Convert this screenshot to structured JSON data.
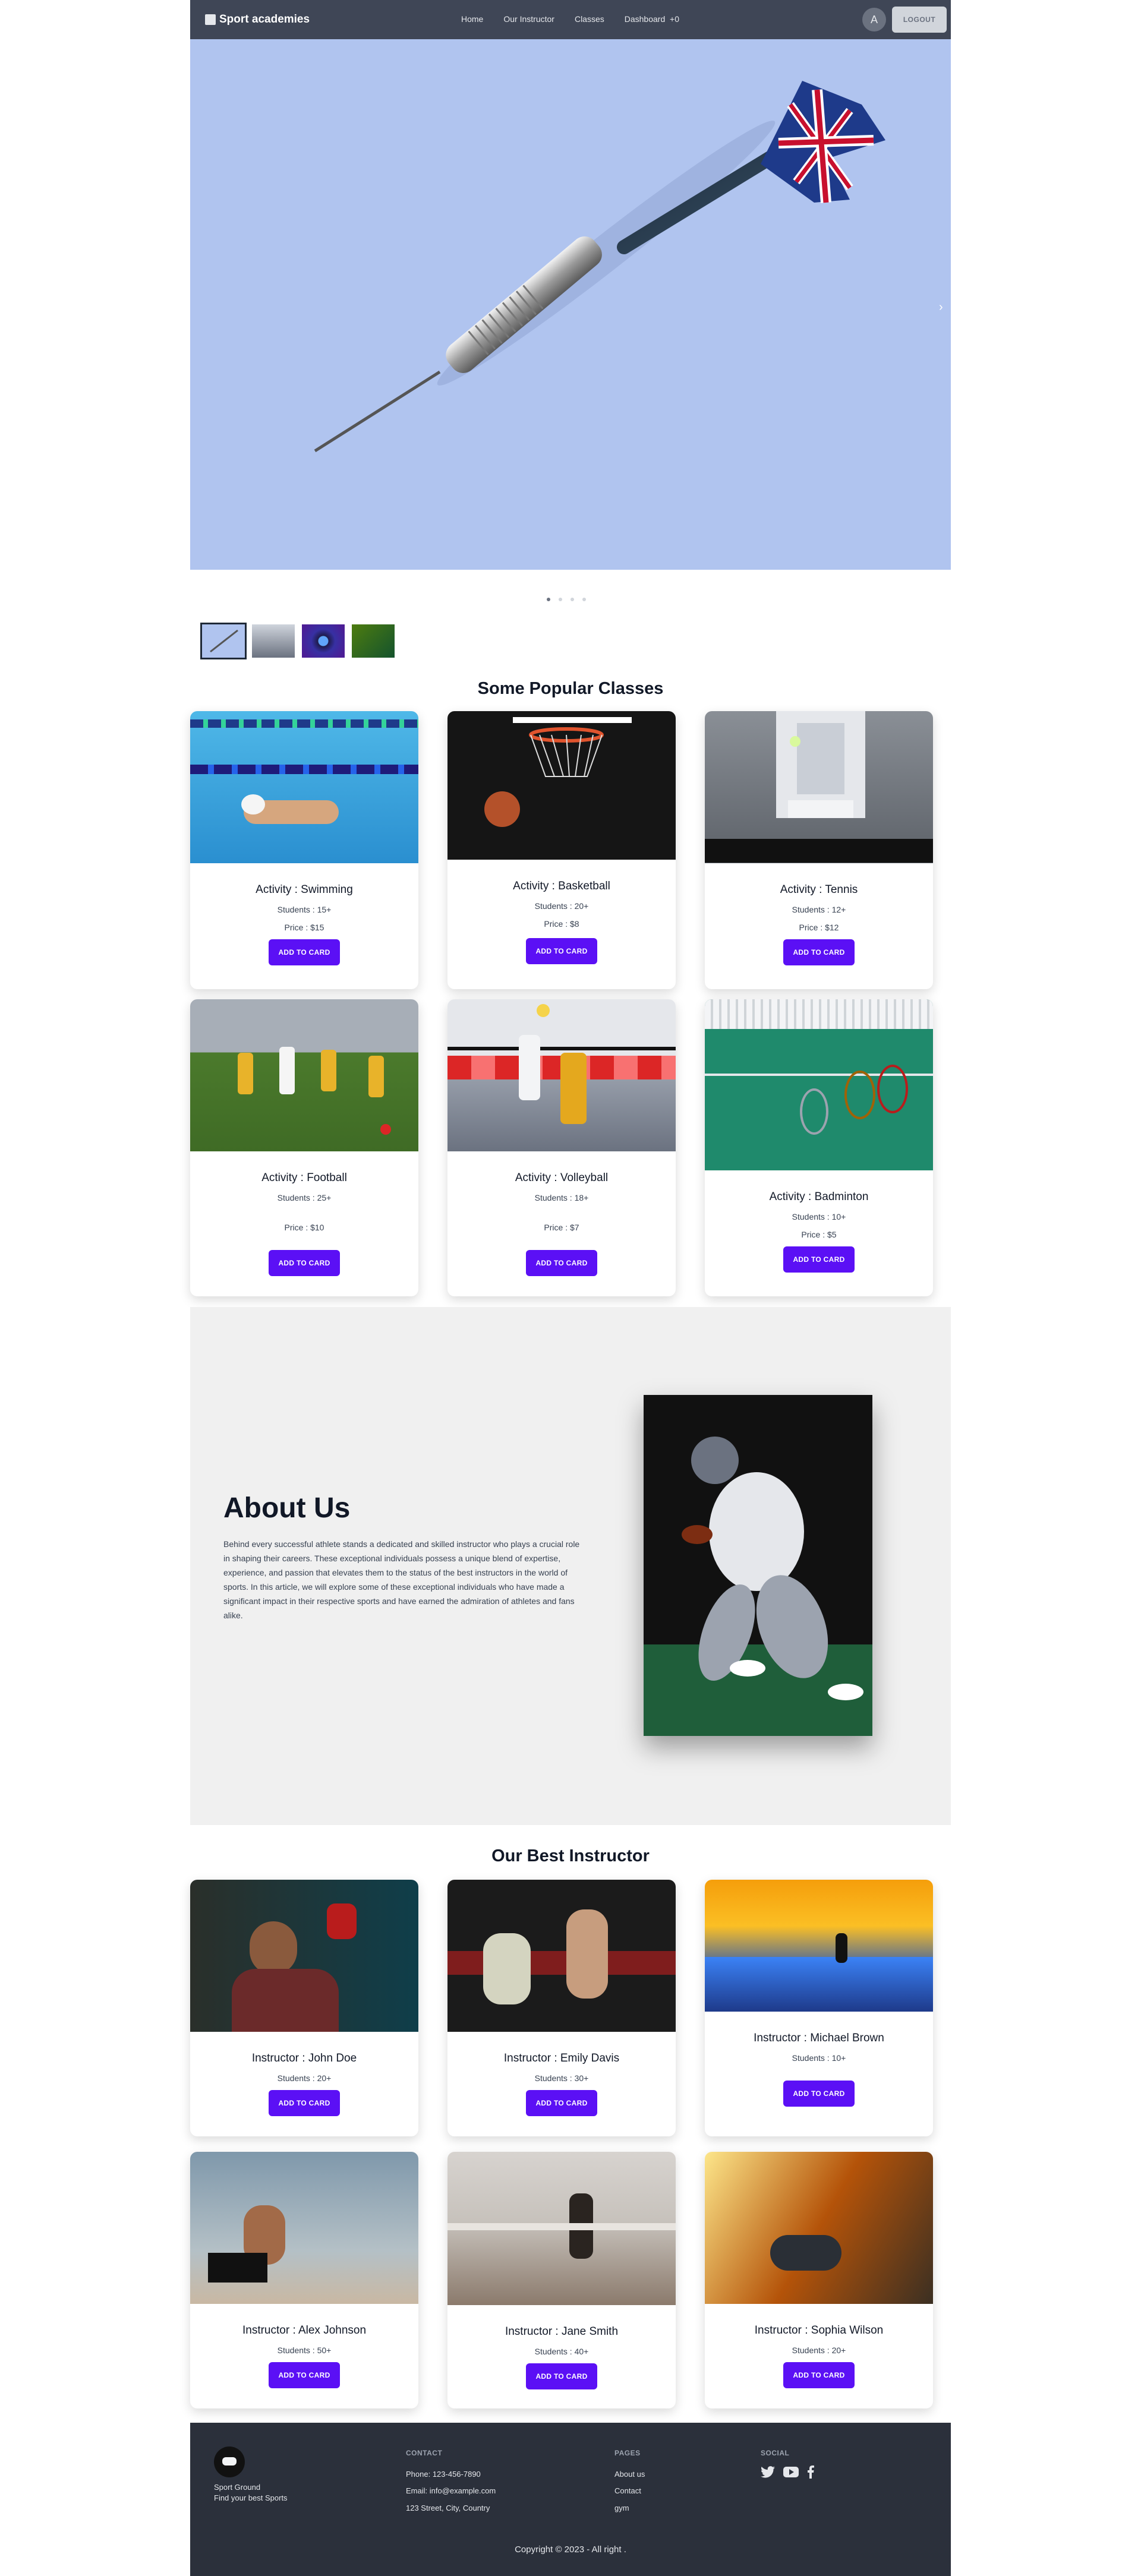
{
  "navbar": {
    "brand": "Sport academies",
    "links": [
      "Home",
      "Our Instructor",
      "Classes",
      "Dashboard"
    ],
    "cart_count": "+0",
    "avatar_letter": "A",
    "logout": "LOGOUT"
  },
  "hero": {
    "next_arrow": "›"
  },
  "classes": {
    "title": "Some Popular Classes",
    "button": "ADD TO CARD",
    "items": [
      {
        "activity": "Activity : Swimming",
        "students": "Students : 15+",
        "price": "Price : $15"
      },
      {
        "activity": "Activity : Basketball",
        "students": "Students : 20+",
        "price": "Price : $8"
      },
      {
        "activity": "Activity : Tennis",
        "students": "Students : 12+",
        "price": "Price : $12"
      },
      {
        "activity": "Activity : Football",
        "students": "Students : 25+",
        "price": "Price : $10"
      },
      {
        "activity": "Activity : Volleyball",
        "students": "Students : 18+",
        "price": "Price : $7"
      },
      {
        "activity": "Activity : Badminton",
        "students": "Students : 10+",
        "price": "Price : $5"
      }
    ]
  },
  "about": {
    "title": "About Us",
    "text": "Behind every successful athlete stands a dedicated and skilled instructor who plays a crucial role in shaping their careers. These exceptional individuals possess a unique blend of expertise, experience, and passion that elevates them to the status of the best instructors in the world of sports. In this article, we will explore some of these exceptional individuals who have made a significant impact in their respective sports and have earned the admiration of athletes and fans alike."
  },
  "instructors": {
    "title": "Our Best Instructor",
    "button": "ADD TO CARD",
    "items": [
      {
        "name": "Instructor : John Doe",
        "students": "Students : 20+"
      },
      {
        "name": "Instructor : Emily Davis",
        "students": "Students : 30+"
      },
      {
        "name": "Instructor : Michael Brown",
        "students": "Students : 10+"
      },
      {
        "name": "Instructor : Alex Johnson",
        "students": "Students : 50+"
      },
      {
        "name": "Instructor : Jane Smith",
        "students": "Students : 40+"
      },
      {
        "name": "Instructor : Sophia Wilson",
        "students": "Students : 20+"
      }
    ]
  },
  "footer": {
    "brand_name": "Sport Ground",
    "tagline": "Find your best Sports",
    "contact_title": "CONTACT",
    "phone": "Phone: 123-456-7890",
    "email": "Email: info@example.com",
    "address": "123 Street, City, Country",
    "pages_title": "PAGES",
    "pages": [
      "About us",
      "Contact",
      "gym"
    ],
    "social_title": "SOCIAL",
    "social_icons": [
      "twitter-icon",
      "youtube-icon",
      "facebook-icon"
    ],
    "copyright": "Copyright © 2023 - All right ."
  },
  "colors": {
    "navbar": "#3f4656",
    "accent_button": "#5b10f5",
    "hero_bg": "#b0c4ef",
    "footer": "#2b303b"
  }
}
